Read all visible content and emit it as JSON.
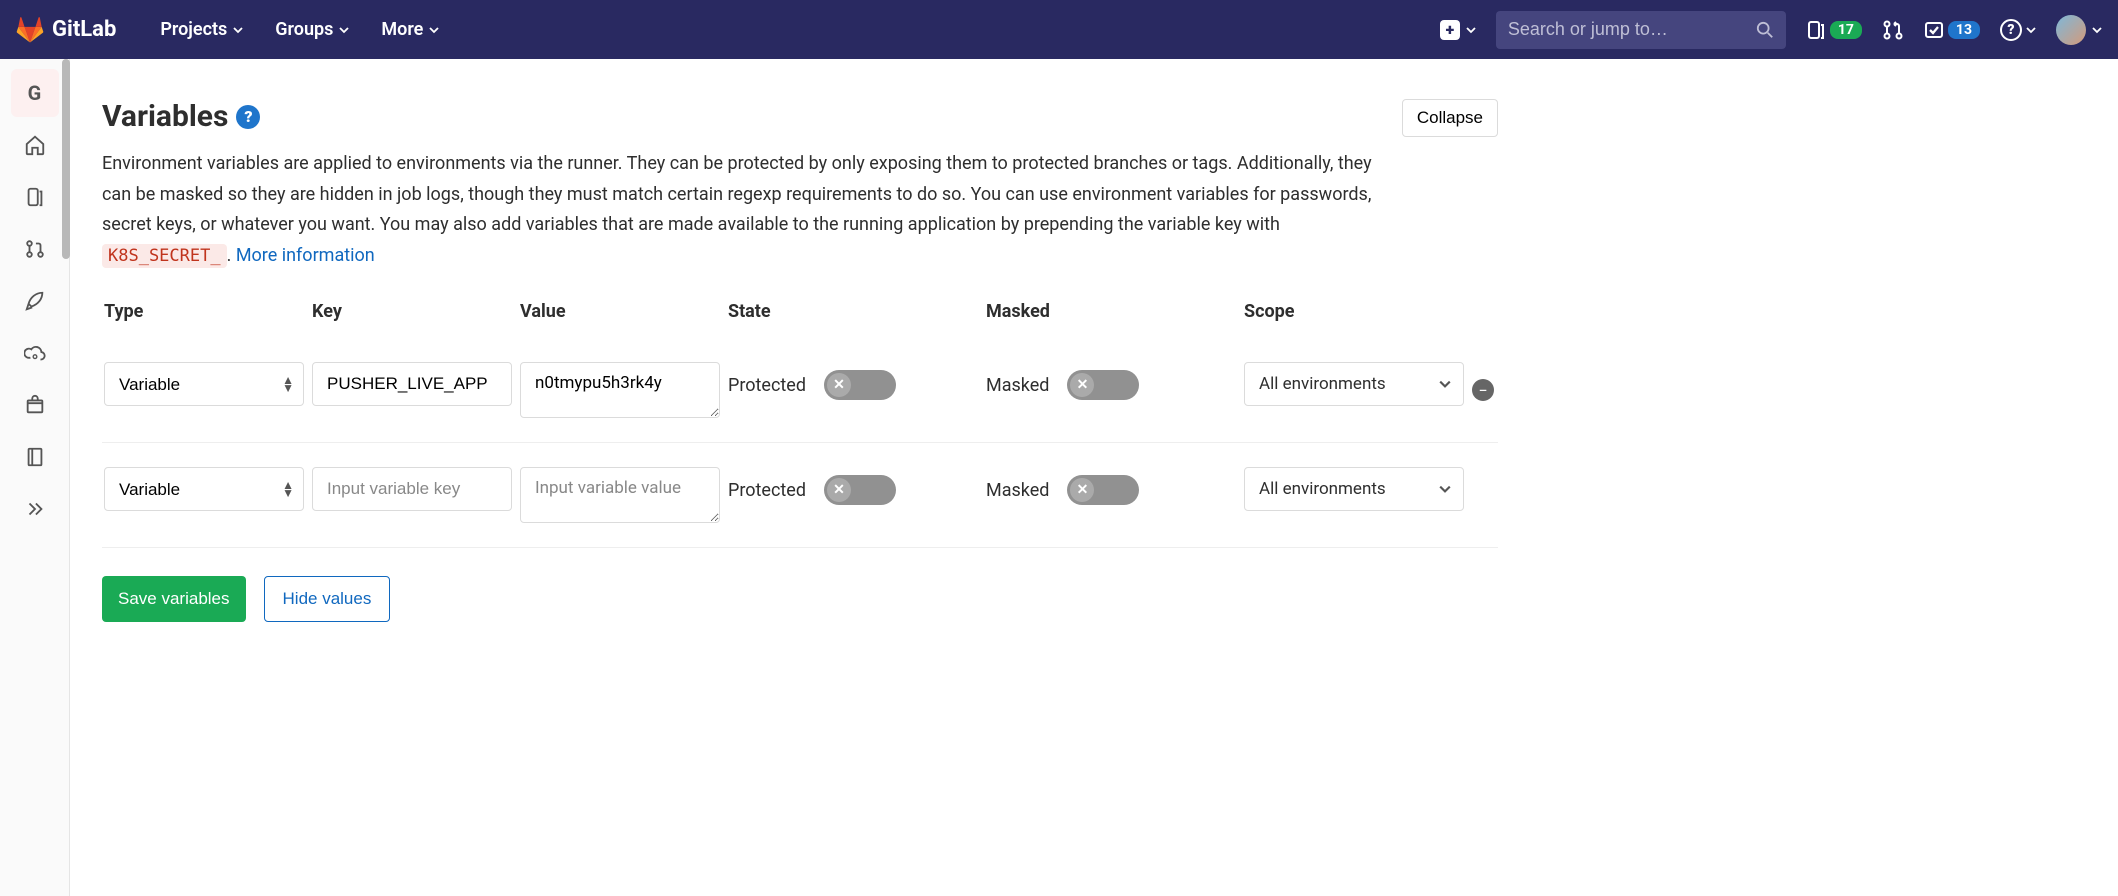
{
  "topbar": {
    "brand": "GitLab",
    "nav": {
      "projects": "Projects",
      "groups": "Groups",
      "more": "More"
    },
    "search_placeholder": "Search or jump to…",
    "issues_count": "17",
    "todos_count": "13"
  },
  "sidebar": {
    "project_letter": "G"
  },
  "section": {
    "title": "Variables",
    "collapse_label": "Collapse",
    "desc_pre": "Environment variables are applied to environments via the runner. They can be protected by only exposing them to protected branches or tags. Additionally, they can be masked so they are hidden in job logs, though they must match certain regexp requirements to do so. You can use environment variables for passwords, secret keys, or whatever you want. You may also add variables that are made available to the running application by prepending the variable key with ",
    "code": "K8S_SECRET_",
    "desc_post": ". ",
    "more_info": "More information"
  },
  "table": {
    "headers": {
      "type": "Type",
      "key": "Key",
      "value": "Value",
      "state": "State",
      "masked": "Masked",
      "scope": "Scope"
    },
    "state_label": "Protected",
    "masked_label": "Masked",
    "type_option": "Variable",
    "scope_option": "All environments",
    "key_placeholder": "Input variable key",
    "value_placeholder": "Input variable value",
    "rows": [
      {
        "key": "PUSHER_LIVE_APP",
        "value": "n0tmypu5h3rk4y"
      },
      {
        "key": "",
        "value": ""
      }
    ]
  },
  "actions": {
    "save": "Save variables",
    "hide": "Hide values"
  }
}
